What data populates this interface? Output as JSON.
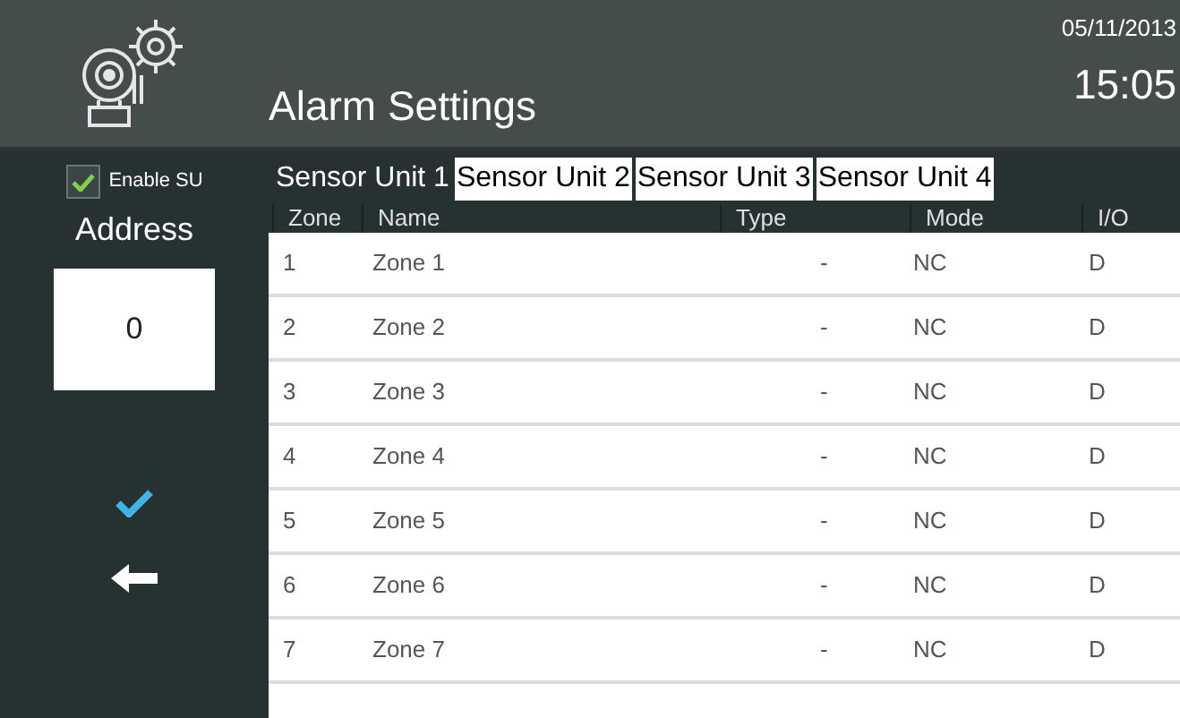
{
  "header": {
    "title": "Alarm Settings",
    "date": "05/11/2013",
    "time": "15:05"
  },
  "sidebar": {
    "enable": {
      "label": "Enable SU",
      "checked": true
    },
    "address_label": "Address",
    "address_value": "0"
  },
  "tabs": [
    {
      "label": "Sensor Unit 1",
      "selected": true
    },
    {
      "label": "Sensor Unit 2",
      "selected": false
    },
    {
      "label": "Sensor Unit 3",
      "selected": false
    },
    {
      "label": "Sensor Unit 4",
      "selected": false
    }
  ],
  "table": {
    "columns": [
      "Zone",
      "Name",
      "Type",
      "Mode",
      "I/O"
    ],
    "rows": [
      [
        "1",
        "Zone 1",
        "-",
        "NC",
        "D"
      ],
      [
        "2",
        "Zone 2",
        "-",
        "NC",
        "D"
      ],
      [
        "3",
        "Zone 3",
        "-",
        "NC",
        "D"
      ],
      [
        "4",
        "Zone 4",
        "-",
        "NC",
        "D"
      ],
      [
        "5",
        "Zone 5",
        "-",
        "NC",
        "D"
      ],
      [
        "6",
        "Zone 6",
        "-",
        "NC",
        "D"
      ],
      [
        "7",
        "Zone 7",
        "-",
        "NC",
        "D"
      ]
    ]
  }
}
